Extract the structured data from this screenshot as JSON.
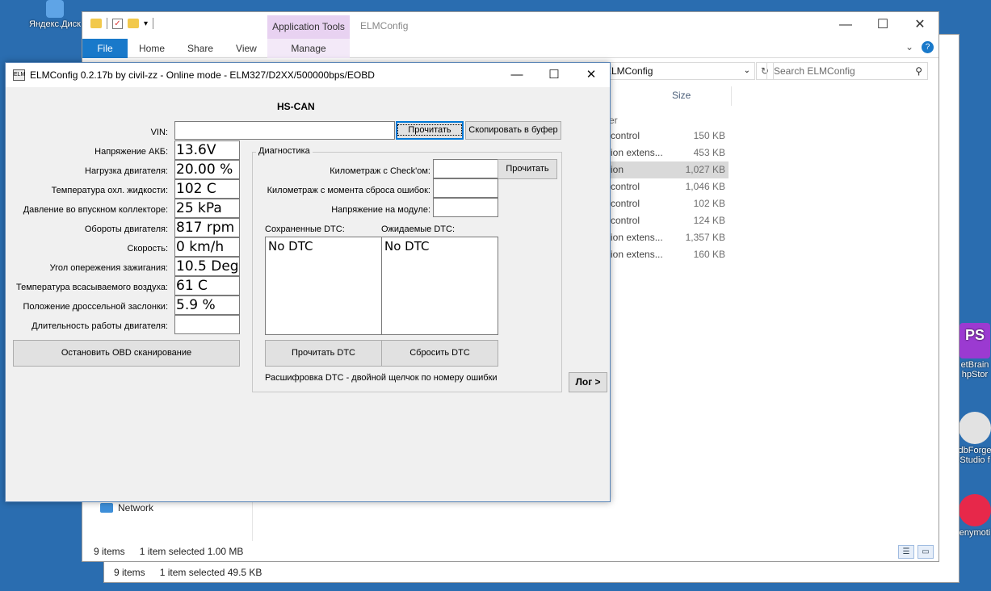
{
  "desktop": {
    "yandex_label": "Яндекс.Диск",
    "phpstorm_label_1": "etBrain",
    "phpstorm_label_2": "hpStor",
    "dbforge_label_1": "dbForge",
    "dbforge_label_2": "Studio f",
    "genymotion_label": "enymoti"
  },
  "back_explorer": {
    "status_items": "9 items",
    "status_selected": "1 item selected  49.5 KB"
  },
  "front_explorer": {
    "title": "ELMConfig",
    "app_tools": "Application Tools",
    "tabs": {
      "file": "File",
      "home": "Home",
      "share": "Share",
      "view": "View",
      "manage": "Manage"
    },
    "address": "ELMConfig",
    "search_placeholder": "Search ELMConfig",
    "column_size": "Size",
    "partial_header": "er",
    "files": [
      {
        "name": "control",
        "size": "150 KB"
      },
      {
        "name": "ion extens...",
        "size": "453 KB"
      },
      {
        "name": "ion",
        "size": "1,027 KB"
      },
      {
        "name": "control",
        "size": "1,046 KB"
      },
      {
        "name": "control",
        "size": "102 KB"
      },
      {
        "name": "control",
        "size": "124 KB"
      },
      {
        "name": "ion extens...",
        "size": "1,357 KB"
      },
      {
        "name": "ion extens...",
        "size": "160 KB"
      }
    ],
    "nav_network": "Network",
    "status_items": "9 items",
    "status_selected": "1 item selected  1.00 MB"
  },
  "elm": {
    "title": "ELMConfig 0.2.17b by civil-zz - Online mode - ELM327/D2XX/500000bps/EOBD",
    "protocol": "HS-CAN",
    "vin_label": "VIN:",
    "vin_value": "",
    "read_button": "Прочитать",
    "copy_button": "Скопировать в буфер",
    "params": [
      {
        "label": "Напряжение АКБ:",
        "value": "13.6V"
      },
      {
        "label": "Нагрузка двигателя:",
        "value": "20.00 %"
      },
      {
        "label": "Температура охл. жидкости:",
        "value": "102 C"
      },
      {
        "label": "Давление во впускном коллекторе:",
        "value": "25 kPa"
      },
      {
        "label": "Обороты двигателя:",
        "value": "817 rpm"
      },
      {
        "label": "Скорость:",
        "value": "0 km/h"
      },
      {
        "label": "Угол опережения зажигания:",
        "value": "10.5 Deg"
      },
      {
        "label": "Температура всасываемого воздуха:",
        "value": "61 C"
      },
      {
        "label": "Положение дроссельной заслонки:",
        "value": "5.9 %"
      },
      {
        "label": "Длительность работы двигателя:",
        "value": ""
      }
    ],
    "stop_button": "Остановить OBD сканирование",
    "diag": {
      "title": "Диагностика",
      "mileage_check_label": "Километраж с Check'ом:",
      "mileage_reset_label": "Километраж с момента сброса ошибок:",
      "module_voltage_label": "Напряжение на модуле:",
      "read_button": "Прочитать",
      "saved_dtc_label": "Сохраненные DTC:",
      "pending_dtc_label": "Ожидаемые DTC:",
      "saved_dtc_items": [
        "No DTC"
      ],
      "pending_dtc_items": [
        "No DTC"
      ],
      "read_dtc_button": "Прочитать DTC",
      "clear_dtc_button": "Сбросить DTC",
      "hint": "Расшифровка DTC - двойной щелчок по номеру ошибки"
    },
    "log_button": "Лог >"
  }
}
